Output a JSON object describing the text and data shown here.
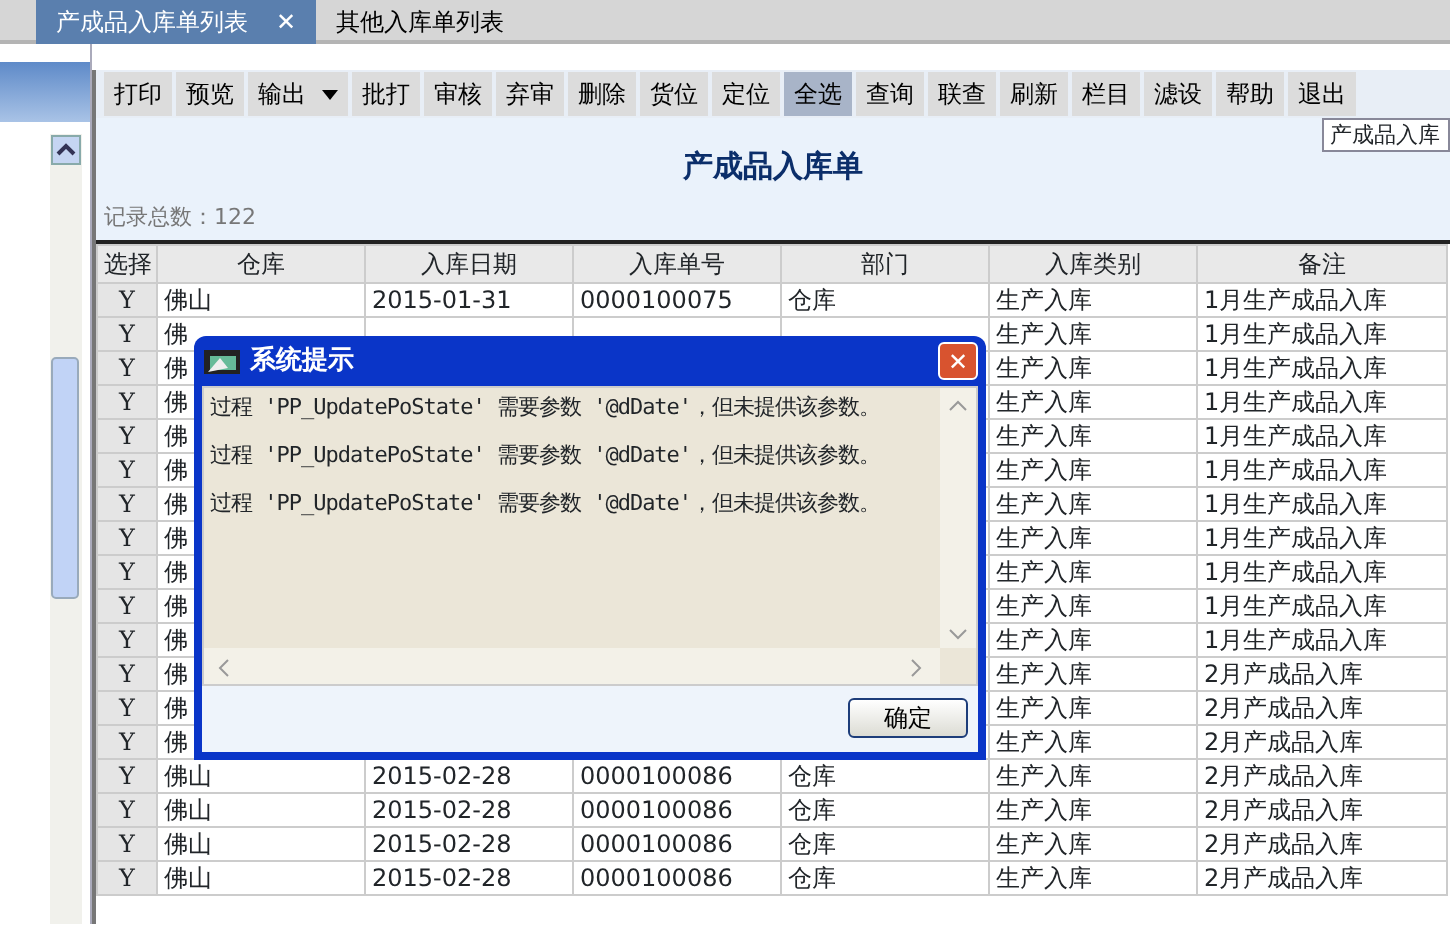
{
  "tabs": [
    {
      "label": "产成品入库单列表",
      "selected": true,
      "close": "✕"
    },
    {
      "label": "其他入库单列表",
      "selected": false
    }
  ],
  "toolbar": [
    {
      "label": "打印",
      "kind": "button",
      "selected": false
    },
    {
      "label": "预览",
      "kind": "button",
      "selected": false
    },
    {
      "label": "输出",
      "kind": "dropdown",
      "selected": false
    },
    {
      "label": "批打",
      "kind": "button",
      "selected": false
    },
    {
      "label": "审核",
      "kind": "button",
      "selected": false
    },
    {
      "label": "弃审",
      "kind": "button",
      "selected": false
    },
    {
      "label": "删除",
      "kind": "button",
      "selected": false
    },
    {
      "label": "货位",
      "kind": "button",
      "selected": false
    },
    {
      "label": "定位",
      "kind": "button",
      "selected": false
    },
    {
      "label": "全选",
      "kind": "button",
      "selected": true
    },
    {
      "label": "查询",
      "kind": "button",
      "selected": false
    },
    {
      "label": "联查",
      "kind": "button",
      "selected": false
    },
    {
      "label": "刷新",
      "kind": "button",
      "selected": false
    },
    {
      "label": "栏目",
      "kind": "button",
      "selected": false
    },
    {
      "label": "滤设",
      "kind": "button",
      "selected": false
    },
    {
      "label": "帮助",
      "kind": "button",
      "selected": false
    },
    {
      "label": "退出",
      "kind": "button",
      "selected": false
    }
  ],
  "search_box": {
    "value": "产成品入库"
  },
  "report_title": "产成品入库单",
  "record_count": "记录总数：122",
  "table": {
    "columns": [
      "选择",
      "仓库",
      "入库日期",
      "入库单号",
      "部门",
      "入库类别",
      "备注"
    ],
    "rows": [
      {
        "cells": [
          "Y",
          "佛山",
          "2015-01-31",
          "0000100075",
          "仓库",
          "生产入库",
          "1月生产成品入库"
        ]
      },
      {
        "cells": [
          "Y",
          "佛",
          "",
          "",
          "",
          "生产入库",
          "1月生产成品入库"
        ]
      },
      {
        "cells": [
          "Y",
          "佛",
          "",
          "",
          "",
          "生产入库",
          "1月生产成品入库"
        ]
      },
      {
        "cells": [
          "Y",
          "佛",
          "",
          "",
          "",
          "生产入库",
          "1月生产成品入库"
        ]
      },
      {
        "cells": [
          "Y",
          "佛",
          "",
          "",
          "",
          "生产入库",
          "1月生产成品入库"
        ]
      },
      {
        "cells": [
          "Y",
          "佛",
          "",
          "",
          "",
          "生产入库",
          "1月生产成品入库"
        ]
      },
      {
        "cells": [
          "Y",
          "佛",
          "",
          "",
          "",
          "生产入库",
          "1月生产成品入库"
        ]
      },
      {
        "cells": [
          "Y",
          "佛",
          "",
          "",
          "",
          "生产入库",
          "1月生产成品入库"
        ]
      },
      {
        "cells": [
          "Y",
          "佛",
          "",
          "",
          "",
          "生产入库",
          "1月生产成品入库"
        ]
      },
      {
        "cells": [
          "Y",
          "佛",
          "",
          "",
          "",
          "生产入库",
          "1月生产成品入库"
        ]
      },
      {
        "cells": [
          "Y",
          "佛",
          "",
          "",
          "",
          "生产入库",
          "1月生产成品入库"
        ]
      },
      {
        "cells": [
          "Y",
          "佛",
          "",
          "",
          "",
          "生产入库",
          "2月产成品入库"
        ]
      },
      {
        "cells": [
          "Y",
          "佛",
          "",
          "",
          "",
          "生产入库",
          "2月产成品入库"
        ]
      },
      {
        "cells": [
          "Y",
          "佛",
          "",
          "",
          "",
          "生产入库",
          "2月产成品入库"
        ]
      },
      {
        "cells": [
          "Y",
          "佛山",
          "2015-02-28",
          "0000100086",
          "仓库",
          "生产入库",
          "2月产成品入库"
        ]
      },
      {
        "cells": [
          "Y",
          "佛山",
          "2015-02-28",
          "0000100086",
          "仓库",
          "生产入库",
          "2月产成品入库"
        ]
      },
      {
        "cells": [
          "Y",
          "佛山",
          "2015-02-28",
          "0000100086",
          "仓库",
          "生产入库",
          "2月产成品入库"
        ]
      },
      {
        "cells": [
          "Y",
          "佛山",
          "2015-02-28",
          "0000100086",
          "仓库",
          "生产入库",
          "2月产成品入库"
        ]
      }
    ]
  },
  "dialog": {
    "title": "系统提示",
    "close": "✕",
    "messages": [
      "过程 'PP_UpdatePoState' 需要参数 '@dDate'，但未提供该参数。",
      "过程 'PP_UpdatePoState' 需要参数 '@dDate'，但未提供该参数。",
      "过程 'PP_UpdatePoState' 需要参数 '@dDate'，但未提供该参数。"
    ],
    "button": "确定"
  }
}
